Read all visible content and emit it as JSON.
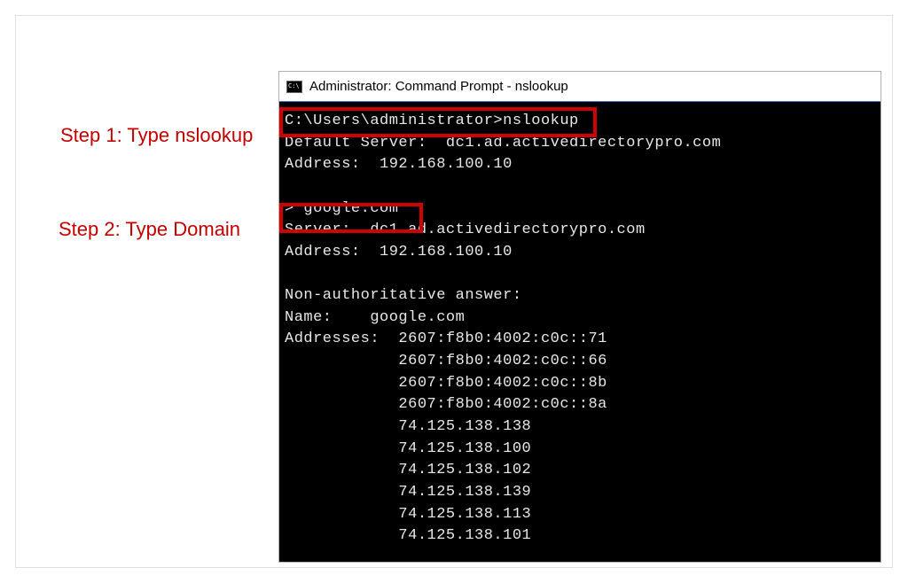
{
  "annotations": {
    "step1": "Step 1: Type nslookup",
    "step2": "Step 2: Type Domain"
  },
  "window": {
    "title": "Administrator: Command Prompt - nslookup"
  },
  "terminal": {
    "prompt1": "C:\\Users\\administrator>nslookup",
    "defaultServer": "Default Server:  dc1.ad.activedirectorypro.com",
    "defaultAddress": "Address:  192.168.100.10",
    "prompt2": "> google.com",
    "server": "Server:  dc1.ad.activedirectorypro.com",
    "address": "Address:  192.168.100.10",
    "nonAuthLabel": "Non-authoritative answer:",
    "nameLine": "Name:    google.com",
    "addressesLabel": "Addresses:  2607:f8b0:4002:c0c::71",
    "addrIndent1": "            2607:f8b0:4002:c0c::66",
    "addrIndent2": "            2607:f8b0:4002:c0c::8b",
    "addrIndent3": "            2607:f8b0:4002:c0c::8a",
    "addrIndent4": "            74.125.138.138",
    "addrIndent5": "            74.125.138.100",
    "addrIndent6": "            74.125.138.102",
    "addrIndent7": "            74.125.138.139",
    "addrIndent8": "            74.125.138.113",
    "addrIndent9": "            74.125.138.101"
  }
}
